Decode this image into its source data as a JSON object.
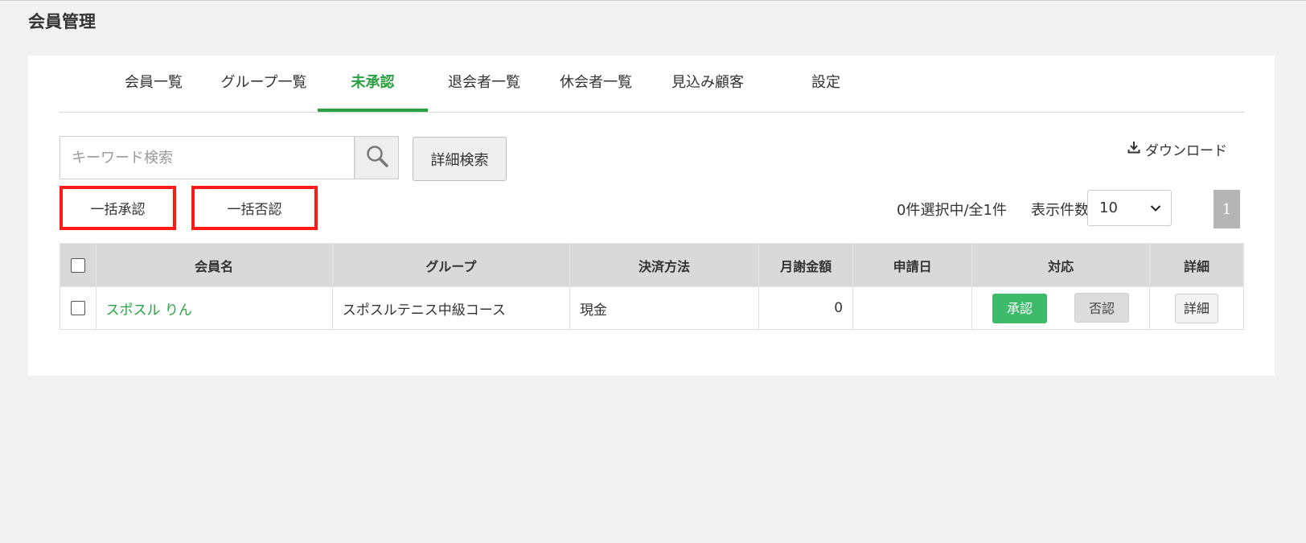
{
  "page_title": "会員管理",
  "tabs": [
    {
      "label": "会員一覧"
    },
    {
      "label": "グループ一覧"
    },
    {
      "label": "未承認",
      "active": true
    },
    {
      "label": "退会者一覧"
    },
    {
      "label": "休会者一覧"
    },
    {
      "label": "見込み顧客"
    },
    {
      "label": "設定"
    }
  ],
  "search": {
    "placeholder": "キーワード検索",
    "icon": "search-icon"
  },
  "advanced_search_label": "詳細検索",
  "download_label": "ダウンロード",
  "bulk": {
    "approve_label": "一括承認",
    "reject_label": "一括否認",
    "highlight_color": "#ff1a1a"
  },
  "selection_status": "0件選択中/全1件",
  "per_page": {
    "label": "表示件数:",
    "value": "10"
  },
  "pagination": {
    "current": "1"
  },
  "table": {
    "headers": [
      "会員名",
      "グループ",
      "決済方法",
      "月謝金額",
      "申請日",
      "対応",
      "詳細"
    ],
    "rows": [
      {
        "name": "スポスル りん",
        "group": "スポスルテニス中級コース",
        "payment": "現金",
        "fee": "0",
        "applied_date": "",
        "approve_label": "承認",
        "reject_label": "否認",
        "detail_label": "詳細"
      }
    ]
  },
  "colors": {
    "accent": "#2aa141",
    "approve": "#3dbb6b",
    "header_bg": "#d9d9d9"
  }
}
